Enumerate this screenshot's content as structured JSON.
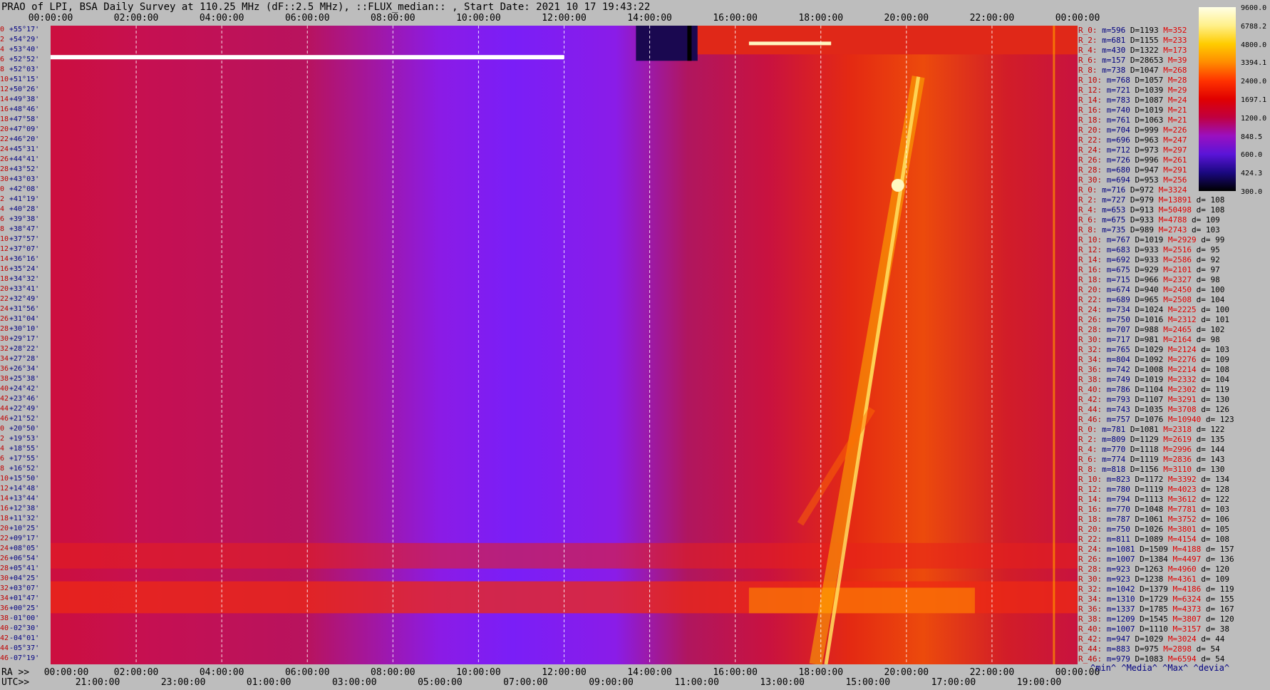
{
  "title": "PRAO of LPI, BSA Daily Survey at 110.25 MHz (dF::2.5 MHz), ::FLUX_median:: , Start Date: 2021 10 17 19:43:22",
  "chart_data": {
    "type": "heatmap",
    "title": "PRAO of LPI, BSA Daily Survey at 110.25 MHz (dF::2.5 MHz), ::FLUX_median:: , Start Date: 2021 10 17 19:43:22",
    "x_top_ticks": [
      "00:00:00",
      "02:00:00",
      "04:00:00",
      "06:00:00",
      "08:00:00",
      "10:00:00",
      "12:00:00",
      "14:00:00",
      "16:00:00",
      "18:00:00",
      "20:00:00",
      "22:00:00",
      "00:00:00"
    ],
    "x_bottom_ra_label": "RA >>",
    "x_bottom_ra_ticks": [
      "00:00:00",
      "02:00:00",
      "04:00:00",
      "06:00:00",
      "08:00:00",
      "10:00:00",
      "12:00:00",
      "14:00:00",
      "16:00:00",
      "18:00:00",
      "20:00:00",
      "22:00:00",
      "00:00:00"
    ],
    "x_bottom_utc_label": "UTC>>",
    "x_bottom_utc_ticks": [
      "21:00:00",
      "23:00:00",
      "01:00:00",
      "03:00:00",
      "05:00:00",
      "07:00:00",
      "09:00:00",
      "11:00:00",
      "13:00:00",
      "15:00:00",
      "17:00:00",
      "19:00:00"
    ],
    "colorbar": {
      "min": 300.0,
      "max": 9600.0,
      "labels": [
        "9600.0",
        "6788.2",
        "4800.0",
        "3394.1",
        "2400.0",
        "1697.1",
        "1200.0",
        "848.5",
        "600.0",
        "424.3",
        "300.0"
      ]
    },
    "declinations": [
      "+55°17'",
      "+54°29'",
      "+53°40'",
      "+52°52'",
      "+52°03'",
      "+51°15'",
      "+50°26'",
      "+49°38'",
      "+48°46'",
      "+47°58'",
      "+47°09'",
      "+46°20'",
      "+45°31'",
      "+44°41'",
      "+43°52'",
      "+43°03'",
      "+42°08'",
      "+41°19'",
      "+40°28'",
      "+39°38'",
      "+38°47'",
      "+37°57'",
      "+37°07'",
      "+36°16'",
      "+35°24'",
      "+34°32'",
      "+33°41'",
      "+32°49'",
      "+31°56'",
      "+31°04'",
      "+30°10'",
      "+29°17'",
      "+28°22'",
      "+27°28'",
      "+26°34'",
      "+25°38'",
      "+24°42'",
      "+23°46'",
      "+22°49'",
      "+21°52'",
      "+20°50'",
      "+19°53'",
      "+18°55'",
      "+17°55'",
      "+16°52'",
      "+15°50'",
      "+14°48'",
      "+13°44'",
      "+12°38'",
      "+11°32'",
      "+10°25'",
      "+09°17'",
      "+08°05'",
      "+06°54'",
      "+05°41'",
      "+04°25'",
      "+03°07'",
      "+01°47'",
      "+00°25'",
      "-01°00'",
      "-02°30'",
      "-04°01'",
      "-05°37'",
      "-07°19'"
    ],
    "decl_index": [
      "0",
      "2",
      "4",
      "6",
      "8",
      "10",
      "12",
      "14",
      "16",
      "18",
      "20",
      "22",
      "24",
      "26",
      "28",
      "30",
      "0",
      "2",
      "4",
      "6",
      "8",
      "10",
      "12",
      "14",
      "16",
      "18",
      "20",
      "22",
      "24",
      "26",
      "28",
      "30",
      "32",
      "34",
      "36",
      "38",
      "40",
      "42",
      "44",
      "46",
      "0",
      "2",
      "4",
      "6",
      "8",
      "10",
      "12",
      "14",
      "16",
      "18",
      "20",
      "22",
      "24",
      "26",
      "28",
      "30",
      "32",
      "34",
      "36",
      "38",
      "40",
      "42",
      "44",
      "46"
    ],
    "rows": [
      {
        "label": "R_0:",
        "min": "596",
        "med": "1193",
        "max": "352",
        "d": ""
      },
      {
        "label": "R_2:",
        "min": "681",
        "med": "1155",
        "max": "233",
        "d": ""
      },
      {
        "label": "R_4:",
        "min": "430",
        "med": "1322",
        "max": "173",
        "d": ""
      },
      {
        "label": "R_6:",
        "min": "157",
        "med": "28653",
        "max": "39",
        "d": ""
      },
      {
        "label": "R_8:",
        "min": "738",
        "med": "1047",
        "max": "268",
        "d": ""
      },
      {
        "label": "R_10:",
        "min": "768",
        "med": "1057",
        "max": "28",
        "d": ""
      },
      {
        "label": "R_12:",
        "min": "721",
        "med": "1039",
        "max": "29",
        "d": ""
      },
      {
        "label": "R_14:",
        "min": "783",
        "med": "1087",
        "max": "24",
        "d": ""
      },
      {
        "label": "R_16:",
        "min": "740",
        "med": "1019",
        "max": "21",
        "d": ""
      },
      {
        "label": "R_18:",
        "min": "761",
        "med": "1063",
        "max": "21",
        "d": ""
      },
      {
        "label": "R_20:",
        "min": "704",
        "med": "999",
        "max": "226",
        "d": ""
      },
      {
        "label": "R_22:",
        "min": "696",
        "med": "963",
        "max": "247",
        "d": ""
      },
      {
        "label": "R_24:",
        "min": "712",
        "med": "973",
        "max": "297",
        "d": ""
      },
      {
        "label": "R_26:",
        "min": "726",
        "med": "996",
        "max": "261",
        "d": ""
      },
      {
        "label": "R_28:",
        "min": "680",
        "med": "947",
        "max": "291",
        "d": ""
      },
      {
        "label": "R_30:",
        "min": "694",
        "med": "953",
        "max": "256",
        "d": ""
      },
      {
        "label": "R_0:",
        "min": "716",
        "med": "972",
        "max": "3324",
        "d": ""
      },
      {
        "label": "R_2:",
        "min": "727",
        "med": "979",
        "max": "13891",
        "d": "108"
      },
      {
        "label": "R_4:",
        "min": "653",
        "med": "913",
        "max": "50498",
        "d": "108"
      },
      {
        "label": "R_6:",
        "min": "675",
        "med": "933",
        "max": "4788",
        "d": "109"
      },
      {
        "label": "R_8:",
        "min": "735",
        "med": "989",
        "max": "2743",
        "d": "103"
      },
      {
        "label": "R_10:",
        "min": "767",
        "med": "1019",
        "max": "2929",
        "d": "99"
      },
      {
        "label": "R_12:",
        "min": "683",
        "med": "933",
        "max": "2516",
        "d": "95"
      },
      {
        "label": "R_14:",
        "min": "692",
        "med": "933",
        "max": "2586",
        "d": "92"
      },
      {
        "label": "R_16:",
        "min": "675",
        "med": "929",
        "max": "2101",
        "d": "97"
      },
      {
        "label": "R_18:",
        "min": "715",
        "med": "966",
        "max": "2327",
        "d": "98"
      },
      {
        "label": "R_20:",
        "min": "674",
        "med": "940",
        "max": "2450",
        "d": "100"
      },
      {
        "label": "R_22:",
        "min": "689",
        "med": "965",
        "max": "2508",
        "d": "104"
      },
      {
        "label": "R_24:",
        "min": "734",
        "med": "1024",
        "max": "2225",
        "d": "100"
      },
      {
        "label": "R_26:",
        "min": "750",
        "med": "1016",
        "max": "2312",
        "d": "101"
      },
      {
        "label": "R_28:",
        "min": "707",
        "med": "988",
        "max": "2465",
        "d": "102"
      },
      {
        "label": "R_30:",
        "min": "717",
        "med": "981",
        "max": "2164",
        "d": "98"
      },
      {
        "label": "R_32:",
        "min": "765",
        "med": "1029",
        "max": "2124",
        "d": "103"
      },
      {
        "label": "R_34:",
        "min": "804",
        "med": "1092",
        "max": "2276",
        "d": "109"
      },
      {
        "label": "R_36:",
        "min": "742",
        "med": "1008",
        "max": "2214",
        "d": "108"
      },
      {
        "label": "R_38:",
        "min": "749",
        "med": "1019",
        "max": "2332",
        "d": "104"
      },
      {
        "label": "R_40:",
        "min": "786",
        "med": "1104",
        "max": "2302",
        "d": "119"
      },
      {
        "label": "R_42:",
        "min": "793",
        "med": "1107",
        "max": "3291",
        "d": "130"
      },
      {
        "label": "R_44:",
        "min": "743",
        "med": "1035",
        "max": "3708",
        "d": "126"
      },
      {
        "label": "R_46:",
        "min": "757",
        "med": "1076",
        "max": "10940",
        "d": "123"
      },
      {
        "label": "R_0:",
        "min": "781",
        "med": "1081",
        "max": "2318",
        "d": "122"
      },
      {
        "label": "R_2:",
        "min": "809",
        "med": "1129",
        "max": "2619",
        "d": "135"
      },
      {
        "label": "R_4:",
        "min": "770",
        "med": "1118",
        "max": "2996",
        "d": "144"
      },
      {
        "label": "R_6:",
        "min": "774",
        "med": "1119",
        "max": "2836",
        "d": "143"
      },
      {
        "label": "R_8:",
        "min": "818",
        "med": "1156",
        "max": "3110",
        "d": "130"
      },
      {
        "label": "R_10:",
        "min": "823",
        "med": "1172",
        "max": "3392",
        "d": "134"
      },
      {
        "label": "R_12:",
        "min": "780",
        "med": "1119",
        "max": "4023",
        "d": "128"
      },
      {
        "label": "R_14:",
        "min": "794",
        "med": "1113",
        "max": "3612",
        "d": "122"
      },
      {
        "label": "R_16:",
        "min": "770",
        "med": "1048",
        "max": "7781",
        "d": "103"
      },
      {
        "label": "R_18:",
        "min": "787",
        "med": "1061",
        "max": "3752",
        "d": "106"
      },
      {
        "label": "R_20:",
        "min": "750",
        "med": "1026",
        "max": "3801",
        "d": "105"
      },
      {
        "label": "R_22:",
        "min": "811",
        "med": "1089",
        "max": "4154",
        "d": "108"
      },
      {
        "label": "R_24:",
        "min": "1081",
        "med": "1509",
        "max": "4188",
        "d": "157"
      },
      {
        "label": "R_26:",
        "min": "1007",
        "med": "1384",
        "max": "4497",
        "d": "136"
      },
      {
        "label": "R_28:",
        "min": "923",
        "med": "1263",
        "max": "4960",
        "d": "120"
      },
      {
        "label": "R_30:",
        "min": "923",
        "med": "1238",
        "max": "4361",
        "d": "109"
      },
      {
        "label": "R_32:",
        "min": "1042",
        "med": "1379",
        "max": "4186",
        "d": "119"
      },
      {
        "label": "R_34:",
        "min": "1310",
        "med": "1729",
        "max": "6324",
        "d": "155"
      },
      {
        "label": "R_36:",
        "min": "1337",
        "med": "1785",
        "max": "4373",
        "d": "167"
      },
      {
        "label": "R_38:",
        "min": "1209",
        "med": "1545",
        "max": "3807",
        "d": "120"
      },
      {
        "label": "R_40:",
        "min": "1007",
        "med": "1110",
        "max": "3157",
        "d": "38"
      },
      {
        "label": "R_42:",
        "min": "947",
        "med": "1029",
        "max": "3024",
        "d": "44"
      },
      {
        "label": "R_44:",
        "min": "883",
        "med": "975",
        "max": "2898",
        "d": "54"
      },
      {
        "label": "R_46:",
        "min": "979",
        "med": "1083",
        "max": "6594",
        "d": "54"
      }
    ],
    "stat_legend": "^min^ ^Media^ ^Max^ ^devia^"
  },
  "colors": {
    "background": "#bdbdbd",
    "grid_line": "#ffffff",
    "label_red": "#c00000",
    "label_blue": "#000080"
  }
}
